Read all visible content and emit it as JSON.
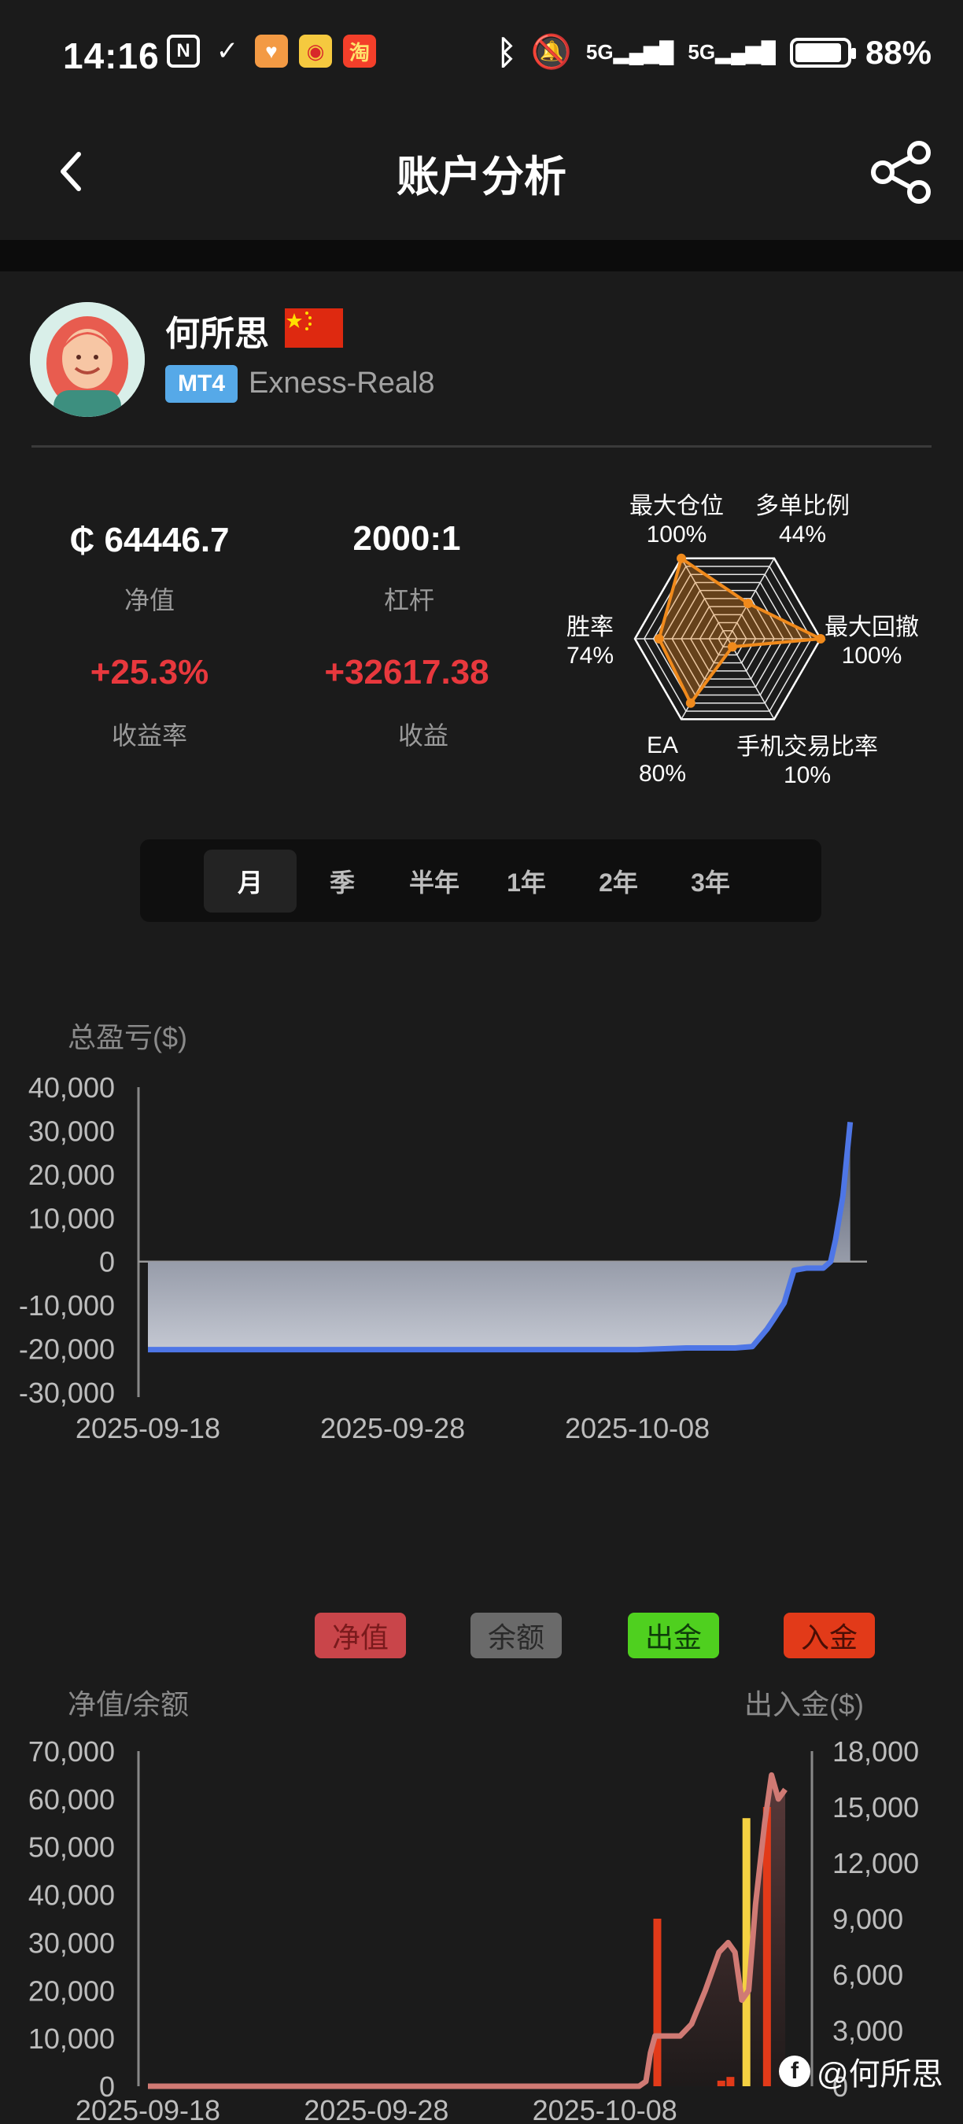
{
  "status_bar": {
    "time": "14:16",
    "battery": "88%",
    "battery_level": 0.88,
    "icons_left": [
      "nfc-icon",
      "app-icon",
      "heart-app-icon",
      "weibo-icon",
      "taobao-icon"
    ],
    "icons_right": [
      "bluetooth-icon",
      "mute-icon",
      "signal-5g-icon",
      "signal-5g-icon",
      "battery-icon"
    ]
  },
  "header": {
    "title": "账户分析"
  },
  "profile": {
    "name": "何所思",
    "platform": "MT4",
    "server": "Exness-Real8",
    "flag_color": "#de2910"
  },
  "stats": {
    "equity_value": "₵ 64446.7",
    "equity_label": "净值",
    "leverage_value": "2000:1",
    "leverage_label": "杠杆",
    "return_value": "+25.3%",
    "return_label": "收益率",
    "profit_value": "+32617.38",
    "profit_label": "收益"
  },
  "radar": {
    "axes": [
      {
        "name": "最大仓位",
        "value": "100%",
        "ratio": 1.0
      },
      {
        "name": "多单比例",
        "value": "44%",
        "ratio": 0.44
      },
      {
        "name": "最大回撤",
        "value": "100%",
        "ratio": 1.0
      },
      {
        "name": "手机交易比率",
        "value": "10%",
        "ratio": 0.1
      },
      {
        "name": "EA",
        "value": "80%",
        "ratio": 0.8
      },
      {
        "name": "胜率",
        "value": "74%",
        "ratio": 0.74
      }
    ],
    "color": "#f08a1c"
  },
  "tabs": [
    "月",
    "季",
    "半年",
    "1年",
    "2年",
    "3年"
  ],
  "active_tab": 0,
  "chart_data": [
    {
      "type": "area",
      "ylabel": "总盈亏($)",
      "ylim": [
        -30000,
        40000
      ],
      "yticks": [
        "40,000",
        "30,000",
        "20,000",
        "10,000",
        "0",
        "-10,000",
        "-20,000",
        "-30,000"
      ],
      "xticks": [
        "2025-09-18",
        "2025-09-28",
        "2025-10-08"
      ],
      "x": [
        0,
        2,
        5,
        10,
        15,
        20,
        21,
        22,
        23,
        24,
        24.7,
        25,
        25.3,
        25.6,
        26,
        26.4,
        26.9,
        27.3,
        27.6,
        27.9,
        28.1,
        28.4,
        28.7
      ],
      "values": [
        -20200,
        -20200,
        -20200,
        -20200,
        -20200,
        -20200,
        -20000,
        -19800,
        -19800,
        -19800,
        -19500,
        -17500,
        -15500,
        -13000,
        -9500,
        -2000,
        -1500,
        -1500,
        -1500,
        0,
        5000,
        15000,
        32000
      ],
      "line_color": "#4e76e6"
    },
    {
      "type": "line",
      "ylabel": "净值/余额",
      "y2label": "出入金($)",
      "ylim": [
        0,
        70000
      ],
      "y2lim": [
        0,
        18000
      ],
      "yticks": [
        "70,000",
        "60,000",
        "50,000",
        "40,000",
        "30,000",
        "20,000",
        "10,000",
        "0"
      ],
      "y2ticks": [
        "18,000",
        "15,000",
        "12,000",
        "9,000",
        "6,000",
        "3,000",
        "0"
      ],
      "xticks": [
        "2025-09-18",
        "2025-09-28",
        "2025-10-08"
      ],
      "legend": [
        {
          "name": "净值",
          "color": "#c9454a",
          "text_color": "#7a1a1c"
        },
        {
          "name": "余额",
          "color": "#6a6a6a",
          "text_color": "#2a2a2a"
        },
        {
          "name": "出金",
          "color": "#4fd01f",
          "text_color": "#0e3c0a"
        },
        {
          "name": "入金",
          "color": "#e23a19",
          "text_color": "#4a0e05"
        }
      ],
      "equity_x": [
        0,
        5,
        10,
        15,
        20,
        21.5,
        21.8,
        22,
        22.2,
        23.3,
        23.8,
        24.4,
        25,
        25.4,
        25.7,
        26,
        26.3,
        26.6,
        27,
        27.3,
        27.6,
        27.9
      ],
      "equity_values": [
        0,
        0,
        0,
        0,
        0,
        0,
        1000,
        7000,
        10500,
        10500,
        13000,
        20000,
        28000,
        30000,
        28000,
        18000,
        20000,
        38000,
        55000,
        65000,
        60000,
        62000
      ],
      "deposits": [
        {
          "x": 22.3,
          "value": 9000,
          "color": "#e23a19"
        },
        {
          "x": 25.1,
          "value": 300,
          "color": "#e23a19"
        },
        {
          "x": 25.5,
          "value": 500,
          "color": "#e23a19"
        },
        {
          "x": 27.1,
          "value": 15000,
          "color": "#e23a19"
        }
      ],
      "withdrawals": [
        {
          "x": 26.2,
          "value": 14400,
          "color": "#f5d142"
        }
      ]
    }
  ],
  "watermark": "@何所思"
}
